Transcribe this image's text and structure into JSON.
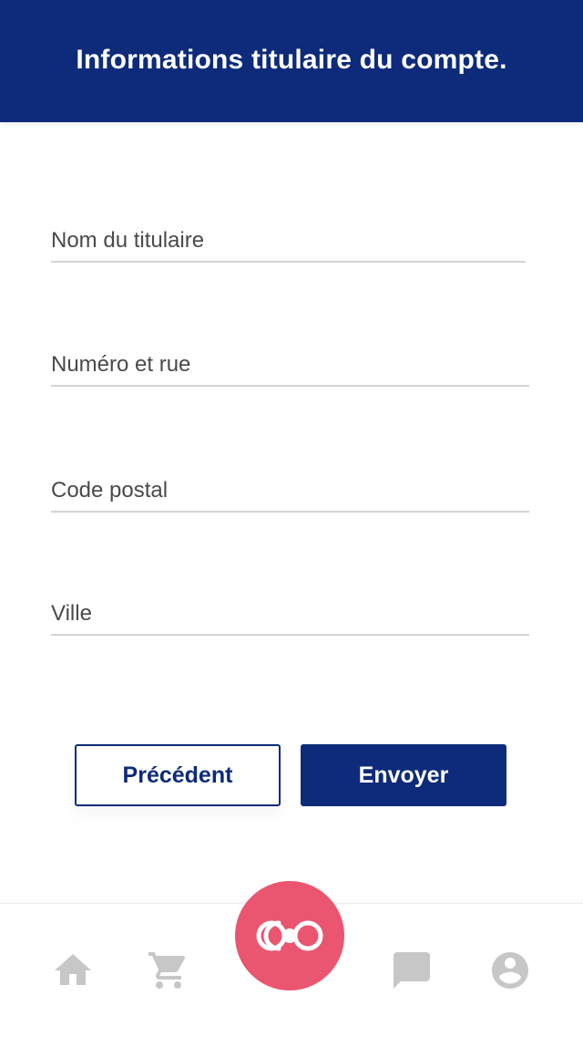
{
  "header": {
    "title": "Informations titulaire du compte."
  },
  "form": {
    "holder_name": {
      "placeholder": "Nom du titulaire",
      "value": ""
    },
    "street": {
      "placeholder": "Numéro et rue",
      "value": ""
    },
    "postal_code": {
      "placeholder": "Code postal",
      "value": ""
    },
    "city": {
      "placeholder": "Ville",
      "value": ""
    }
  },
  "actions": {
    "previous_label": "Précédent",
    "submit_label": "Envoyer"
  },
  "bottom_nav": {
    "items": [
      {
        "icon": "home-icon"
      },
      {
        "icon": "cart-icon"
      },
      {
        "icon": "brand-logo-icon"
      },
      {
        "icon": "chat-icon"
      },
      {
        "icon": "account-icon"
      }
    ]
  },
  "colors": {
    "primary": "#0d2b7a",
    "accent": "#ea5570",
    "nav_icon": "#c7c7c7",
    "divider": "#d4d4d4"
  }
}
